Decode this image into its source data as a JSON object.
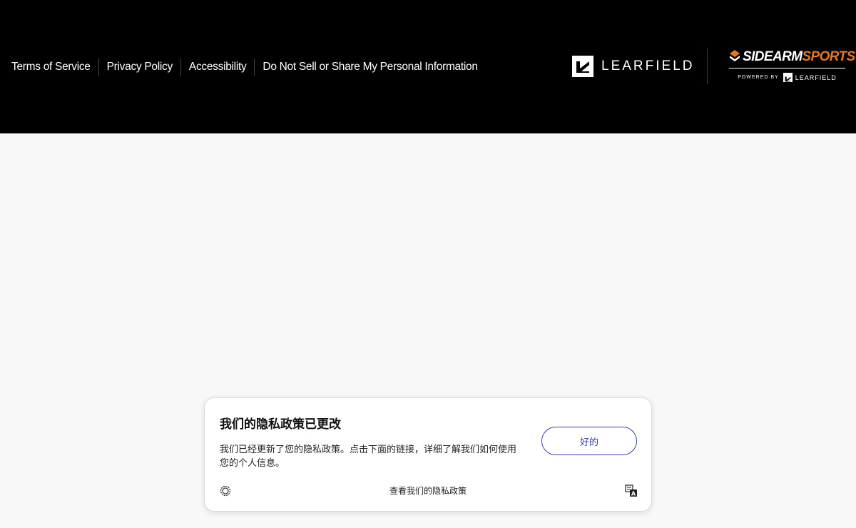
{
  "footer": {
    "links": [
      "Terms of Service",
      "Privacy Policy",
      "Accessibility",
      "Do Not Sell or Share My Personal Information"
    ],
    "learfield_wordmark": "LEARFIELD",
    "sidearm": {
      "logo_white": "SIDEARM",
      "logo_orange": "SPORTS",
      "powered_by": "POWERED BY",
      "powered_brand": "LEARFIELD",
      "accent_color": "#e87722"
    }
  },
  "privacy_banner": {
    "title": "我们的隐私政策已更改",
    "body": "我们已经更新了您的隐私政策。点击下面的链接，详细了解我们如何使用您的个人信息。",
    "ok_button": "好的",
    "view_policy_link": "查看我们的隐私政策",
    "button_color": "#3b3bb8"
  }
}
